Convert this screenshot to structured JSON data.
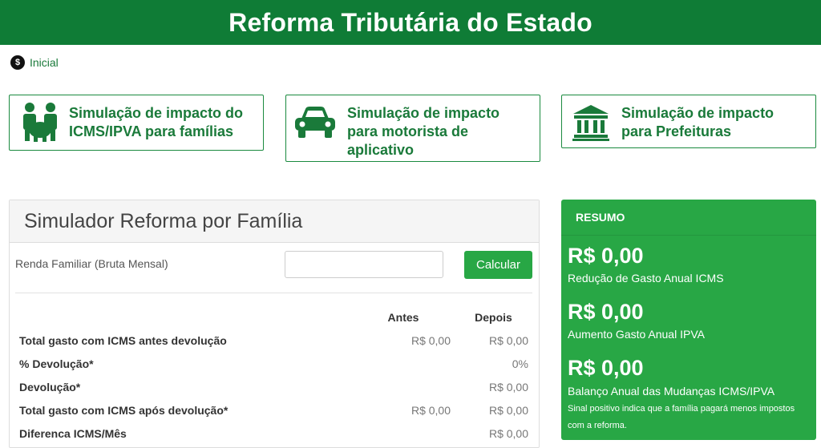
{
  "header": {
    "title": "Reforma Tributária do Estado"
  },
  "breadcrumb": {
    "home_label": "Inicial"
  },
  "cards": [
    {
      "label": "Simulação de impacto do ICMS/IPVA para famílias",
      "icon": "family-icon"
    },
    {
      "label": "Simulação de impacto para motorista de aplicativo",
      "icon": "car-icon"
    },
    {
      "label": "Simulação de impacto para Prefeituras",
      "icon": "bank-icon"
    }
  ],
  "simulator": {
    "title": "Simulador Reforma por Família",
    "renda_label": "Renda Familiar (Bruta Mensal)",
    "renda_value": "",
    "calcular_label": "Calcular",
    "columns": {
      "antes": "Antes",
      "depois": "Depois"
    },
    "rows": [
      {
        "label": "Total gasto com ICMS antes devolução",
        "antes": "R$ 0,00",
        "depois": "R$ 0,00"
      },
      {
        "label": "% Devolução*",
        "antes": "",
        "depois": "0%"
      },
      {
        "label": "Devolução*",
        "antes": "",
        "depois": "R$ 0,00"
      },
      {
        "label": "Total gasto com ICMS após devolução*",
        "antes": "R$ 0,00",
        "depois": "R$ 0,00"
      },
      {
        "label": "Diferenca ICMS/Mês",
        "antes": "",
        "depois": "R$ 0,00"
      }
    ]
  },
  "resumo": {
    "title": "RESUMO",
    "items": [
      {
        "value": "R$ 0,00",
        "label": "Redução de Gasto Anual ICMS"
      },
      {
        "value": "R$ 0,00",
        "label": "Aumento Gasto Anual IPVA"
      },
      {
        "value": "R$ 0,00",
        "label": "Balanço Anual das Mudanças ICMS/IPVA"
      }
    ],
    "note": "Sinal positivo indica que a família pagará menos impostos com a reforma."
  },
  "colors": {
    "brand": "#0f7c36",
    "accent": "#28a745"
  }
}
